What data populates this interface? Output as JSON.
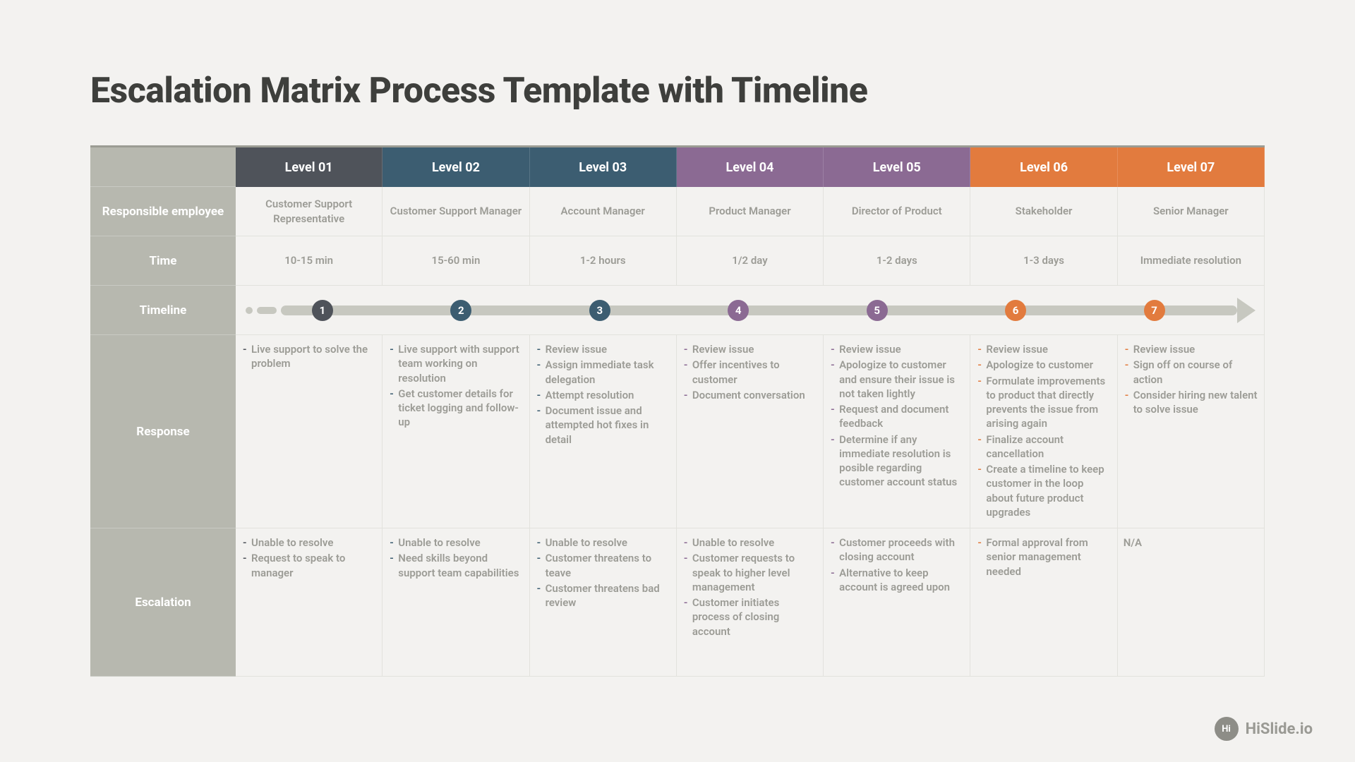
{
  "title": "Escalation Matrix Process Template with Timeline",
  "brand": {
    "badge": "Hi",
    "name": "HiSlide.io"
  },
  "row_labels": {
    "responsible": "Responsible employee",
    "time": "Time",
    "timeline": "Timeline",
    "response": "Response",
    "escalation": "Escalation"
  },
  "colors": {
    "level1": "#4f535a",
    "level2": "#3c5d71",
    "level3": "#3c5d71",
    "level4": "#8b6a93",
    "level5": "#8b6a93",
    "level6": "#e27b3e",
    "level7": "#e27b3e"
  },
  "levels": [
    {
      "label": "Level 01",
      "num": "1",
      "responsible": "Customer Support Representative",
      "time": "10-15 min",
      "response": [
        "Live support to solve the problem"
      ],
      "escalation": [
        "Unable to resolve",
        "Request to speak to manager"
      ]
    },
    {
      "label": "Level 02",
      "num": "2",
      "responsible": "Customer Support Manager",
      "time": "15-60 min",
      "response": [
        "Live support with support team working on resolution",
        "Get customer details for ticket logging and follow-up"
      ],
      "escalation": [
        "Unable to resolve",
        "Need skills beyond support team capabilities"
      ]
    },
    {
      "label": "Level 03",
      "num": "3",
      "responsible": "Account Manager",
      "time": "1-2 hours",
      "response": [
        "Review issue",
        "Assign immediate task delegation",
        "Attempt resolution",
        "Document issue and attempted hot fixes in detail"
      ],
      "escalation": [
        "Unable to resolve",
        "Customer threatens to teave",
        "Customer threatens bad review"
      ]
    },
    {
      "label": "Level 04",
      "num": "4",
      "responsible": "Product Manager",
      "time": "1/2 day",
      "response": [
        "Review issue",
        "Offer incentives to customer",
        "Document conversation"
      ],
      "escalation": [
        "Unable to resolve",
        "Customer requests to speak to higher level management",
        "Customer initiates process of closing account"
      ]
    },
    {
      "label": "Level 05",
      "num": "5",
      "responsible": "Director of Product",
      "time": "1-2 days",
      "response": [
        "Review issue",
        "Apologize to customer and ensure their issue is not taken lightly",
        "Request and document feedback",
        "Determine if any immediate resolution is posible regarding customer account status"
      ],
      "escalation": [
        "Customer proceeds with closing account",
        "Alternative to keep account is agreed upon"
      ]
    },
    {
      "label": "Level 06",
      "num": "6",
      "responsible": "Stakeholder",
      "time": "1-3 days",
      "response": [
        "Review issue",
        "Apologize to customer",
        "Formulate improvements to product that directly prevents the issue from arising again",
        "Finalize account cancellation",
        "Create a timeline to keep customer in the loop about future product upgrades"
      ],
      "escalation": [
        "Formal approval from senior management needed"
      ]
    },
    {
      "label": "Level 07",
      "num": "7",
      "responsible": "Senior Manager",
      "time": "Immediate resolution",
      "response": [
        "Review issue",
        "Sign off on course of action",
        "Consider hiring new talent to solve issue"
      ],
      "escalation": [
        "N/A"
      ]
    }
  ]
}
